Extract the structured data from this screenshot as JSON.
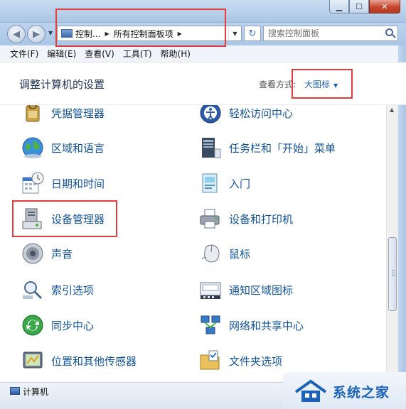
{
  "navigation": {
    "breadcrumbs": [
      "控制...",
      "所有控制面板项"
    ],
    "search_placeholder": "搜索控制面板"
  },
  "menubar": {
    "items": [
      "文件(F)",
      "编辑(E)",
      "查看(V)",
      "工具(T)",
      "帮助(H)"
    ]
  },
  "header": {
    "title": "调整计算机的设置",
    "view_by_label": "查看方式:",
    "view_by_value": "大图标"
  },
  "items": [
    {
      "label": "凭据管理器",
      "icon": "credential-manager-icon"
    },
    {
      "label": "轻松访问中心",
      "icon": "ease-of-access-icon"
    },
    {
      "label": "区域和语言",
      "icon": "globe-icon"
    },
    {
      "label": "任务栏和「开始」菜单",
      "icon": "taskbar-icon"
    },
    {
      "label": "日期和时间",
      "icon": "calendar-clock-icon"
    },
    {
      "label": "入门",
      "icon": "getting-started-icon"
    },
    {
      "label": "设备管理器",
      "icon": "device-manager-icon"
    },
    {
      "label": "设备和打印机",
      "icon": "printer-icon"
    },
    {
      "label": "声音",
      "icon": "speaker-icon"
    },
    {
      "label": "鼠标",
      "icon": "mouse-icon"
    },
    {
      "label": "索引选项",
      "icon": "indexing-icon"
    },
    {
      "label": "通知区域图标",
      "icon": "notification-icon"
    },
    {
      "label": "同步中心",
      "icon": "sync-icon"
    },
    {
      "label": "网络和共享中心",
      "icon": "network-icon"
    },
    {
      "label": "位置和其他传感器",
      "icon": "location-sensor-icon"
    },
    {
      "label": "文件夹选项",
      "icon": "folder-options-icon"
    }
  ],
  "status": {
    "text": "计算机"
  },
  "watermark": {
    "text": "系统之家"
  },
  "colors": {
    "link": "#12539b",
    "highlight": "#e23c3c",
    "view_value": "#1c5fb0"
  }
}
